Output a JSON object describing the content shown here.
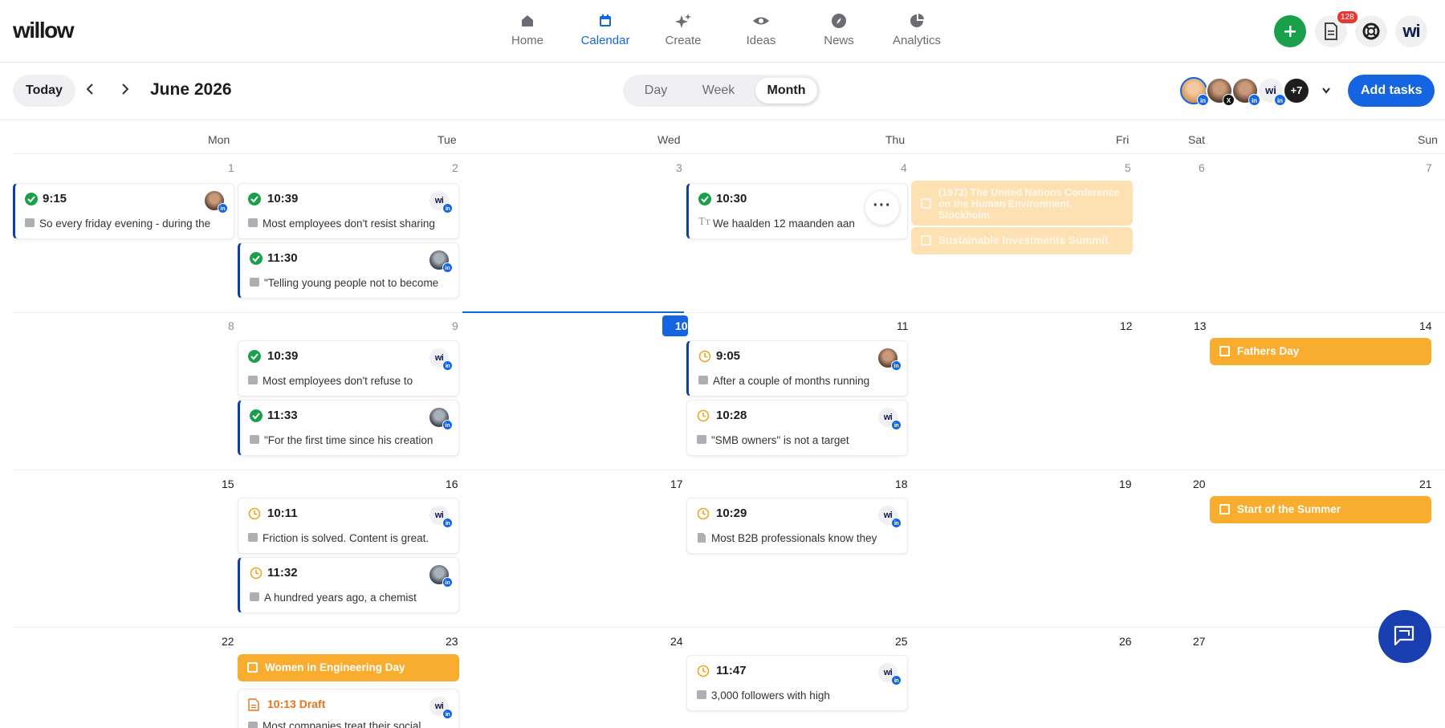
{
  "nav": {
    "logo": "willow",
    "items": [
      {
        "label": "Home",
        "icon": "home-icon"
      },
      {
        "label": "Calendar",
        "icon": "calendar-icon",
        "active": true
      },
      {
        "label": "Create",
        "icon": "sparkle-icon"
      },
      {
        "label": "Ideas",
        "icon": "eye-icon"
      },
      {
        "label": "News",
        "icon": "compass-icon"
      },
      {
        "label": "Analytics",
        "icon": "pie-chart-icon"
      }
    ],
    "notification_count": "128",
    "profile_initials": "wi"
  },
  "toolbar": {
    "today_label": "Today",
    "month_title": "June 2026",
    "views": [
      "Day",
      "Week",
      "Month"
    ],
    "active_view": "Month",
    "extra_accounts": "+7",
    "add_tasks_label": "Add tasks"
  },
  "weekdays": [
    "Mon",
    "Tue",
    "Wed",
    "Thu",
    "Fri",
    "Sat",
    "Sun"
  ],
  "weeks": [
    [
      "1",
      "2",
      "3",
      "4",
      "5",
      "6",
      "7"
    ],
    [
      "8",
      "9",
      "10",
      "11",
      "12",
      "13",
      "14"
    ],
    [
      "15",
      "16",
      "17",
      "18",
      "19",
      "20",
      "21"
    ],
    [
      "22",
      "23",
      "24",
      "25",
      "26",
      "27"
    ]
  ],
  "today_date": "10",
  "posts": [
    {
      "time": "9:15",
      "text": "So every friday evening - during the",
      "status": "published"
    },
    {
      "time": "10:39",
      "text": "Most employees don't resist sharing",
      "status": "published"
    },
    {
      "time": "11:30",
      "text": "\"Telling young people not to become",
      "status": "published"
    },
    {
      "time": "10:30",
      "text": "We haalden 12 maanden aan",
      "status": "published"
    },
    {
      "time": "10:39",
      "text": "Most employees don't refuse to",
      "status": "published"
    },
    {
      "time": "11:33",
      "text": "\"For the first time since his creation",
      "status": "published"
    },
    {
      "time": "9:05",
      "text": "After a couple of months running",
      "status": "scheduled"
    },
    {
      "time": "10:28",
      "text": "\"SMB owners\" is not a target",
      "status": "scheduled"
    },
    {
      "time": "10:11",
      "text": "Friction is solved. Content is great.",
      "status": "scheduled"
    },
    {
      "time": "11:32",
      "text": "A hundred years ago, a chemist",
      "status": "scheduled"
    },
    {
      "time": "10:29",
      "text": "Most B2B professionals know they",
      "status": "scheduled"
    },
    {
      "time": "11:47",
      "text": "3,000 followers with high",
      "status": "scheduled"
    },
    {
      "time": "10:13 Draft",
      "text": "Most companies treat their social",
      "status": "draft"
    }
  ],
  "events": [
    {
      "label": "(1972) The United Nations Conference on the Human Environment, Stockholm",
      "faded": true
    },
    {
      "label": "Sustainable Investments Summit",
      "faded": true
    },
    {
      "label": "Fathers Day"
    },
    {
      "label": "Start of the Summer"
    },
    {
      "label": "Women in Engineering Day"
    }
  ],
  "colors": {
    "accent": "#1565e3",
    "event": "#f8ad2f",
    "published": "#1aa04a",
    "scheduled": "#f0a51c",
    "draft": "#e8731c"
  }
}
